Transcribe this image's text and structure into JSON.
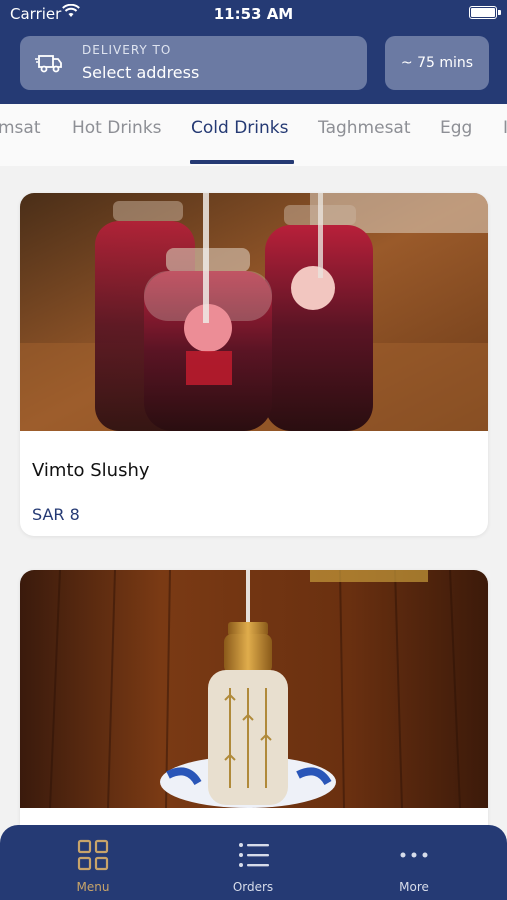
{
  "status_bar": {
    "carrier": "Carrier",
    "time": "11:53 AM"
  },
  "header": {
    "delivery_label": "DELIVERY TO",
    "delivery_value": "Select address",
    "eta": "~ 75 mins"
  },
  "tabs": [
    {
      "label": "msat"
    },
    {
      "label": "Hot Drinks"
    },
    {
      "label": "Cold Drinks",
      "active": true
    },
    {
      "label": "Taghmesat"
    },
    {
      "label": "Egg"
    },
    {
      "label": "I"
    }
  ],
  "items": [
    {
      "name": "Vimto Slushy",
      "price": "SAR 8"
    },
    {
      "name": "",
      "price": ""
    }
  ],
  "tabbar": {
    "items": [
      {
        "label": "Menu",
        "icon": "grid-icon",
        "active": true
      },
      {
        "label": "Orders",
        "icon": "list-icon"
      },
      {
        "label": "More",
        "icon": "more-dots-icon"
      }
    ]
  },
  "colors": {
    "primary": "#253a74",
    "accent_gold": "#c8a46a",
    "inactive": "#8d8f95"
  }
}
